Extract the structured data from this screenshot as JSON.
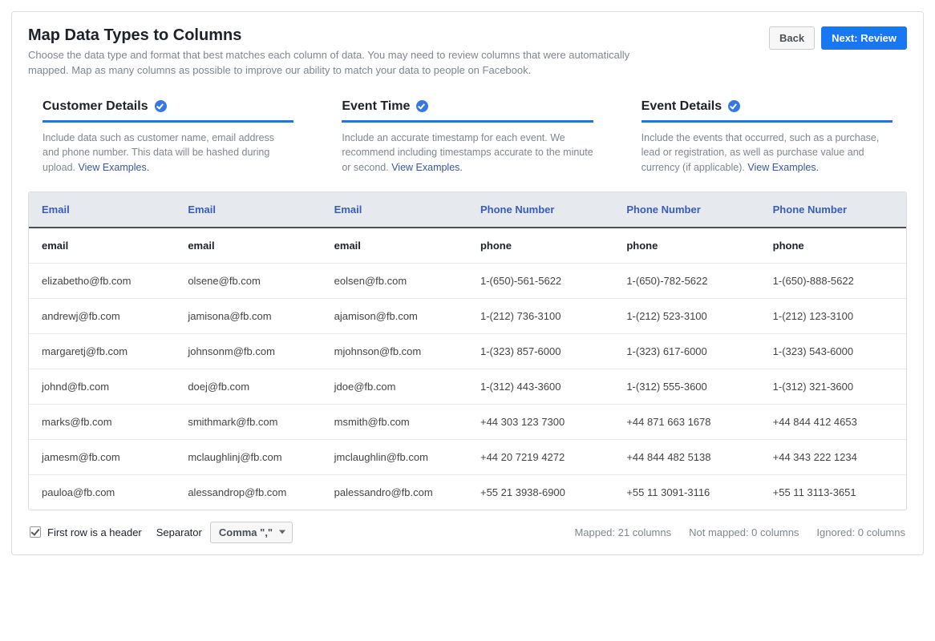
{
  "header": {
    "title": "Map Data Types to Columns",
    "description": "Choose the data type and format that best matches each column of data. You may need to review columns that were automatically mapped. Map as many columns as possible to improve our ability to match your data to people on Facebook.",
    "back_label": "Back",
    "next_label": "Next: Review"
  },
  "cards": [
    {
      "title": "Customer Details",
      "desc": "Include data such as customer name, email address and phone number. This data will be hashed during upload.",
      "link": "View Examples."
    },
    {
      "title": "Event Time",
      "desc": "Include an accurate timestamp for each event. We recommend including timestamps accurate to the minute or second.",
      "link": "View Examples."
    },
    {
      "title": "Event Details",
      "desc": "Include the events that occurred, such as a purchase, lead or registration, as well as purchase value and currency (if applicable).",
      "link": "View Examples."
    }
  ],
  "table": {
    "mapped_headers": [
      "Email",
      "Email",
      "Email",
      "Phone Number",
      "Phone Number",
      "Phone Number"
    ],
    "source_headers": [
      "email",
      "email",
      "email",
      "phone",
      "phone",
      "phone"
    ],
    "rows": [
      [
        "elizabetho@fb.com",
        "olsene@fb.com",
        "eolsen@fb.com",
        "1-(650)-561-5622",
        "1-(650)-782-5622",
        "1-(650)-888-5622"
      ],
      [
        "andrewj@fb.com",
        "jamisona@fb.com",
        "ajamison@fb.com",
        "1-(212) 736-3100",
        "1-(212) 523-3100",
        "1-(212) 123-3100"
      ],
      [
        "margaretj@fb.com",
        "johnsonm@fb.com",
        "mjohnson@fb.com",
        "1-(323) 857-6000",
        "1-(323) 617-6000",
        "1-(323) 543-6000"
      ],
      [
        "johnd@fb.com",
        "doej@fb.com",
        "jdoe@fb.com",
        "1-(312) 443-3600",
        "1-(312) 555-3600",
        "1-(312) 321-3600"
      ],
      [
        "marks@fb.com",
        "smithmark@fb.com",
        "msmith@fb.com",
        "+44 303 123 7300",
        "+44 871 663 1678",
        "+44 844 412 4653"
      ],
      [
        "jamesm@fb.com",
        "mclaughlinj@fb.com",
        "jmclaughlin@fb.com",
        "+44 20 7219 4272",
        "+44 844 482 5138",
        "+44 343 222 1234"
      ],
      [
        "pauloa@fb.com",
        "alessandrop@fb.com",
        "palessandro@fb.com",
        "+55 21 3938-6900",
        "+55 11 3091-3116",
        "+55 11 3113-3651"
      ]
    ]
  },
  "footer": {
    "first_row_label": "First row is a header",
    "first_row_checked": true,
    "separator_label": "Separator",
    "separator_value": "Comma \",\"",
    "mapped_label": "Mapped: 21 columns",
    "not_mapped_label": "Not mapped: 0 columns",
    "ignored_label": "Ignored: 0 columns"
  }
}
